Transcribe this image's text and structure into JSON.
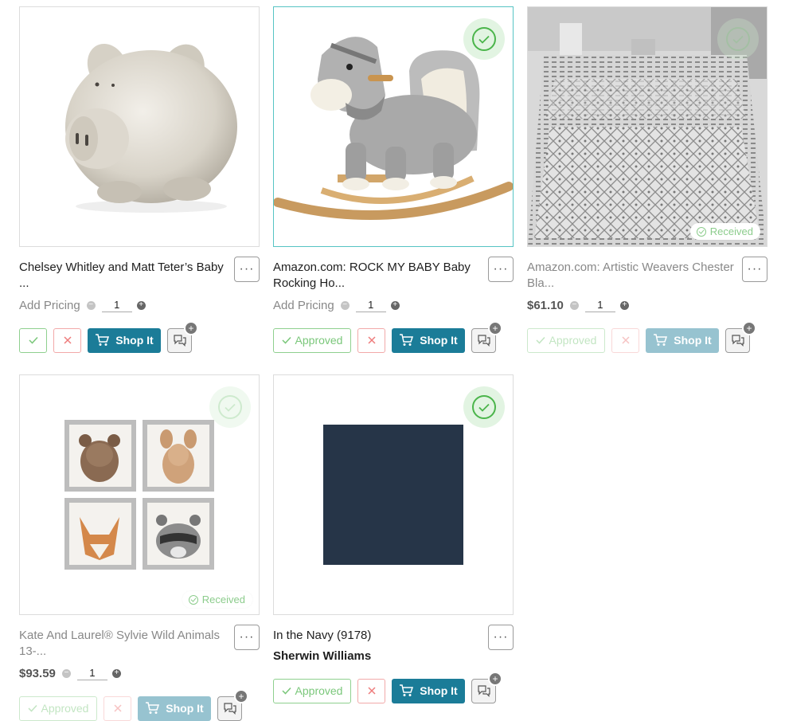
{
  "cards": [
    {
      "title": "Chelsey Whitley and Matt Teter’s Baby ...",
      "price_label": "Add Pricing",
      "qty": "1",
      "approve_label": "",
      "shop_label": "Shop It",
      "image": "piggy-bank"
    },
    {
      "title": "Amazon.com: ROCK MY BABY Baby Rocking Ho...",
      "price_label": "Add Pricing",
      "qty": "1",
      "approve_label": "Approved",
      "shop_label": "Shop It",
      "image": "rocking-horse"
    },
    {
      "title": "Amazon.com: Artistic Weavers Chester Bla...",
      "price": "$61.10",
      "qty": "1",
      "approve_label": "Approved",
      "shop_label": "Shop It",
      "received_label": "Received",
      "image": "area-rug"
    },
    {
      "title": "Kate And Laurel® Sylvie Wild Animals 13-...",
      "price": "$93.59",
      "qty": "1",
      "approve_label": "Approved",
      "shop_label": "Shop It",
      "received_label": "Received",
      "image": "animal-prints"
    },
    {
      "title": "In the Navy (9178)",
      "vendor": "Sherwin Williams",
      "approve_label": "Approved",
      "shop_label": "Shop It",
      "swatch_color": "#263548",
      "image": "paint-swatch"
    }
  ],
  "icons": {
    "more": "more-dots-icon",
    "check": "check-icon",
    "close": "close-icon",
    "cart": "cart-icon",
    "comment": "comment-icon",
    "plus": "plus-icon",
    "minus": "minus-icon"
  },
  "colors": {
    "accent": "#1b7c98",
    "approve": "#7ac77a",
    "reject": "#ee7c7c",
    "selected_border": "#56c4c4"
  }
}
